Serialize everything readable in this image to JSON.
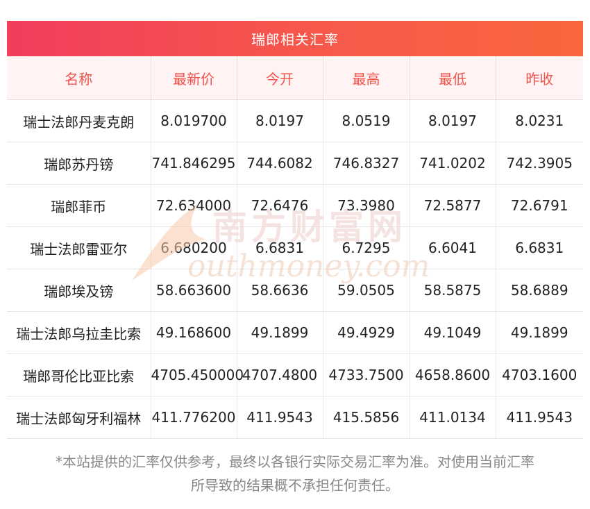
{
  "title": "瑞郎相关汇率",
  "columns": [
    "名称",
    "最新价",
    "今开",
    "最高",
    "最低",
    "昨收"
  ],
  "rows": [
    [
      "瑞士法郎丹麦克朗",
      "8.019700",
      "8.0197",
      "8.0519",
      "8.0197",
      "8.0231"
    ],
    [
      "瑞郎苏丹镑",
      "741.846295",
      "744.6082",
      "746.8327",
      "741.0202",
      "742.3905"
    ],
    [
      "瑞郎菲币",
      "72.634000",
      "72.6476",
      "73.3980",
      "72.5877",
      "72.6791"
    ],
    [
      "瑞士法郎雷亚尔",
      "6.680200",
      "6.6831",
      "6.7295",
      "6.6041",
      "6.6831"
    ],
    [
      "瑞郎埃及镑",
      "58.663600",
      "58.6636",
      "59.0505",
      "58.5875",
      "58.6889"
    ],
    [
      "瑞士法郎乌拉圭比索",
      "49.168600",
      "49.1899",
      "49.4929",
      "49.1049",
      "49.1899"
    ],
    [
      "瑞郎哥伦比亚比索",
      "4705.450000",
      "4707.4800",
      "4733.7500",
      "4658.8600",
      "4703.1600"
    ],
    [
      "瑞士法郎匈牙利福林",
      "411.776200",
      "411.9543",
      "415.5856",
      "411.0134",
      "411.9543"
    ]
  ],
  "watermark": {
    "cn": "南方财富网",
    "en": "outhmoney.com"
  },
  "footnote": {
    "line1": "*本站提供的汇率仅供参考，最终以各银行实际交易汇率为准。对使用当前汇率",
    "line2": "所导致的结果概不承担任何责任。"
  },
  "colors": {
    "title_start": "#f23d5d",
    "title_end": "#f9663c",
    "header_text": "#f0524c",
    "header_bg": "#fff4f3"
  }
}
